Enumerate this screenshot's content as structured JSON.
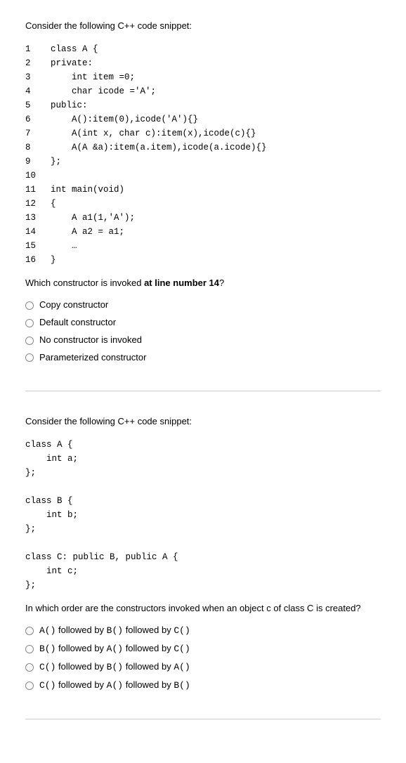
{
  "q1": {
    "prompt": "Consider the following C++ code snippet:",
    "code": [
      {
        "ln": "1",
        "text": "class A {"
      },
      {
        "ln": "2",
        "text": "private:"
      },
      {
        "ln": "3",
        "text": "    int item =0;"
      },
      {
        "ln": "4",
        "text": "    char icode ='A';"
      },
      {
        "ln": "5",
        "text": "public:"
      },
      {
        "ln": "6",
        "text": "    A():item(0),icode('A'){}"
      },
      {
        "ln": "7",
        "text": "    A(int x, char c):item(x),icode(c){}"
      },
      {
        "ln": "8",
        "text": "    A(A &a):item(a.item),icode(a.icode){}"
      },
      {
        "ln": "9",
        "text": "};"
      },
      {
        "ln": "10",
        "text": ""
      },
      {
        "ln": "11",
        "text": "int main(void)"
      },
      {
        "ln": "12",
        "text": "{"
      },
      {
        "ln": "13",
        "text": "    A a1(1,'A');"
      },
      {
        "ln": "14",
        "text": "    A a2 = a1;"
      },
      {
        "ln": "15",
        "text": "    …"
      },
      {
        "ln": "16",
        "text": "}"
      }
    ],
    "question_pre": "Which constructor is invoked ",
    "question_bold": "at line number 14",
    "question_post": "?",
    "options": [
      "Copy constructor",
      "Default constructor",
      "No constructor is invoked",
      "Parameterized constructor"
    ]
  },
  "q2": {
    "prompt": "Consider the following C++ code snippet:",
    "code": "class A {\n    int a;\n};\n\nclass B {\n    int b;\n};\n\nclass C: public B, public A {\n    int c;\n};",
    "question_parts": [
      {
        "t": "In which order are the constructors invoked when an object ",
        "mono": false
      },
      {
        "t": "c",
        "mono": true
      },
      {
        "t": " of ",
        "mono": false
      },
      {
        "t": "class C",
        "mono": true
      },
      {
        "t": " is created?",
        "mono": false
      }
    ],
    "options": [
      [
        {
          "t": "A()",
          "mono": true
        },
        {
          "t": " followed by ",
          "mono": false
        },
        {
          "t": "B()",
          "mono": true
        },
        {
          "t": " followed by ",
          "mono": false
        },
        {
          "t": "C()",
          "mono": true
        }
      ],
      [
        {
          "t": "B()",
          "mono": true
        },
        {
          "t": " followed by ",
          "mono": false
        },
        {
          "t": "A()",
          "mono": true
        },
        {
          "t": " followed by ",
          "mono": false
        },
        {
          "t": "C()",
          "mono": true
        }
      ],
      [
        {
          "t": "C()",
          "mono": true
        },
        {
          "t": " followed by ",
          "mono": false
        },
        {
          "t": "B()",
          "mono": true
        },
        {
          "t": " followed by ",
          "mono": false
        },
        {
          "t": "A()",
          "mono": true
        }
      ],
      [
        {
          "t": "C()",
          "mono": true
        },
        {
          "t": " followed by ",
          "mono": false
        },
        {
          "t": "A()",
          "mono": true
        },
        {
          "t": " followed by ",
          "mono": false
        },
        {
          "t": "B()",
          "mono": true
        }
      ]
    ]
  }
}
